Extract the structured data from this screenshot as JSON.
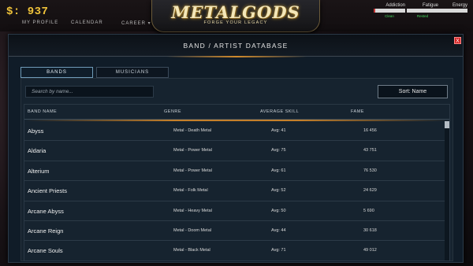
{
  "topbar": {
    "money": "$: 937",
    "nav": [
      "MY PROFILE",
      "CALENDAR",
      "CAREER ▾"
    ],
    "logo": "METALGODS",
    "tagline": "FORGE YOUR LEGACY",
    "stats": [
      {
        "label": "Addiction",
        "status": "Clean",
        "fill": 0.05
      },
      {
        "label": "Fatigue",
        "status": "Rested",
        "fill": 0
      },
      {
        "label": "Energy",
        "status": "",
        "fill": 0
      }
    ]
  },
  "modal": {
    "title": "BAND / ARTIST DATABASE",
    "close_label": "X",
    "tabs": [
      "BANDS",
      "MUSICIANS"
    ],
    "search_placeholder": "Search by name...",
    "sort_label": "Sort: Name",
    "columns": [
      "BAND NAME",
      "GENRE",
      "AVERAGE SKILL",
      "FAME"
    ],
    "rows": [
      {
        "name": "Abyss",
        "genre": "Metal - Death Metal",
        "skill": "Avg: 41",
        "fame": "16 456"
      },
      {
        "name": "Aldaria",
        "genre": "Metal - Power Metal",
        "skill": "Avg: 75",
        "fame": "43 751"
      },
      {
        "name": "Alterium",
        "genre": "Metal - Power Metal",
        "skill": "Avg: 61",
        "fame": "76 530"
      },
      {
        "name": "Ancient Priests",
        "genre": "Metal - Folk Metal",
        "skill": "Avg: 52",
        "fame": "24 629"
      },
      {
        "name": "Arcane Abyss",
        "genre": "Metal - Heavy Metal",
        "skill": "Avg: 50",
        "fame": "5 690"
      },
      {
        "name": "Arcane Reign",
        "genre": "Metal - Doom Metal",
        "skill": "Avg: 44",
        "fame": "30 618"
      },
      {
        "name": "Arcane Souls",
        "genre": "Metal - Black Metal",
        "skill": "Avg: 71",
        "fame": "49 012"
      }
    ]
  },
  "colors": {
    "accent": "#f0c33a",
    "close": "#d42323",
    "status_ok": "#43d65c"
  }
}
